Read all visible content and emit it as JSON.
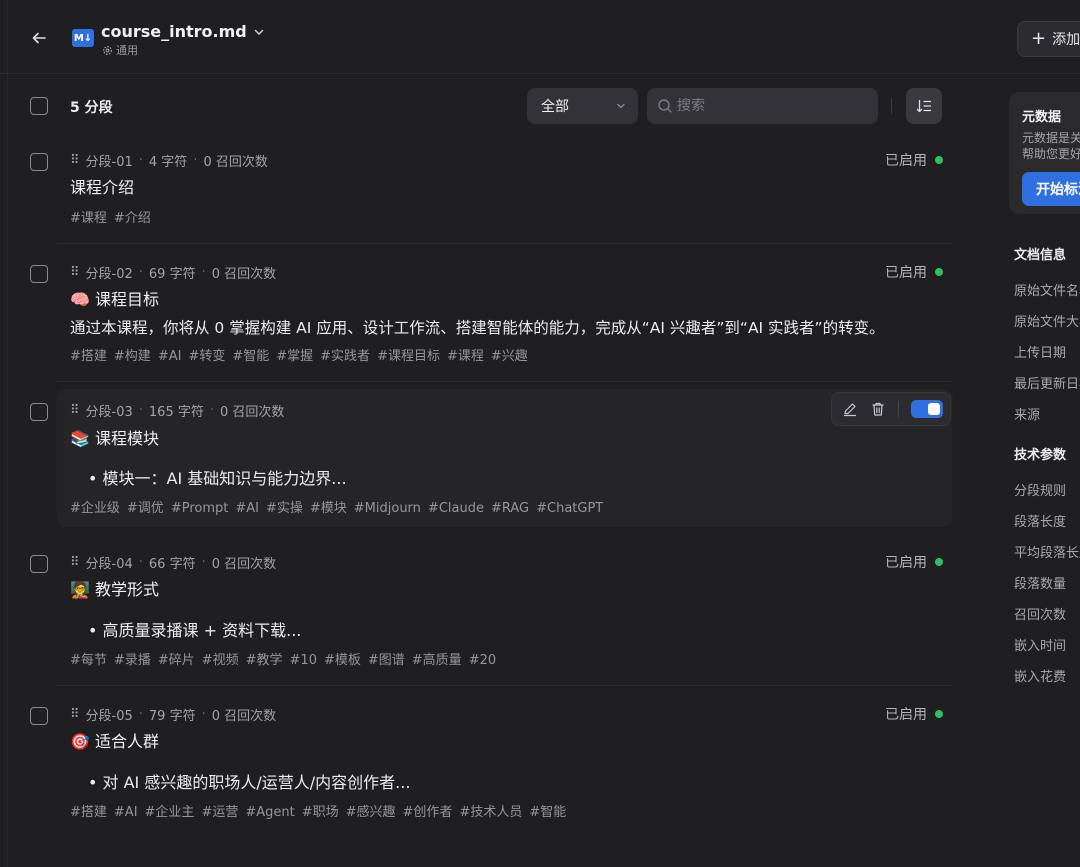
{
  "header": {
    "file_name": "course_intro.md",
    "file_badge": "M↓",
    "category": "通用",
    "add_button": "添加"
  },
  "toolbar": {
    "segment_count": "5 分段",
    "filter_value": "全部",
    "search_placeholder": "搜索"
  },
  "segments": [
    {
      "id": "分段-01",
      "chars": "4 字符",
      "recalls": "0 召回次数",
      "status": "已启用",
      "title": "课程介绍",
      "body": "",
      "tags": [
        "#课程",
        "#介绍"
      ]
    },
    {
      "id": "分段-02",
      "chars": "69 字符",
      "recalls": "0 召回次数",
      "status": "已启用",
      "title": "🧠 课程目标",
      "body": "通过本课程，你将从 0 掌握构建 AI 应用、设计工作流、搭建智能体的能力，完成从“AI 兴趣者”到“AI 实践者”的转变。",
      "tags": [
        "#搭建",
        "#构建",
        "#AI",
        "#转变",
        "#智能",
        "#掌握",
        "#实践者",
        "#课程目标",
        "#课程",
        "#兴趣"
      ]
    },
    {
      "id": "分段-03",
      "chars": "165 字符",
      "recalls": "0 召回次数",
      "status": "",
      "title": "📚 课程模块",
      "body": "• 模块一：AI 基础知识与能力边界...",
      "tags": [
        "#企业级",
        "#调优",
        "#Prompt",
        "#AI",
        "#实操",
        "#模块",
        "#Midjourn",
        "#Claude",
        "#RAG",
        "#ChatGPT"
      ]
    },
    {
      "id": "分段-04",
      "chars": "66 字符",
      "recalls": "0 召回次数",
      "status": "已启用",
      "title": "🧑‍🏫 教学形式",
      "body": "• 高质量录播课 + 资料下载...",
      "tags": [
        "#每节",
        "#录播",
        "#碎片",
        "#视频",
        "#教学",
        "#10",
        "#模板",
        "#图谱",
        "#高质量",
        "#20"
      ]
    },
    {
      "id": "分段-05",
      "chars": "79 字符",
      "recalls": "0 召回次数",
      "status": "已启用",
      "title": "🎯 适合人群",
      "body": "• 对 AI 感兴趣的职场人/运营人/内容创作者...",
      "tags": [
        "#搭建",
        "#AI",
        "#企业主",
        "#运营",
        "#Agent",
        "#职场",
        "#感兴趣",
        "#创作者",
        "#技术人员",
        "#智能"
      ]
    }
  ],
  "sidebar": {
    "metadata_title": "元数据",
    "metadata_desc": "元数据是关于文档的数据，可帮助您更好地组织和检索",
    "metadata_button": "开始标注",
    "doc_info_title": "文档信息",
    "doc_info_items": [
      "原始文件名称",
      "原始文件大小",
      "上传日期",
      "最后更新日期",
      "来源"
    ],
    "tech_title": "技术参数",
    "tech_items": [
      "分段规则",
      "段落长度",
      "平均段落长度",
      "段落数量",
      "召回次数",
      "嵌入时间",
      "嵌入花费"
    ]
  },
  "colors": {
    "accent": "#2f6fe0",
    "enabled": "#2fbf5f",
    "background": "#1f1f21"
  }
}
